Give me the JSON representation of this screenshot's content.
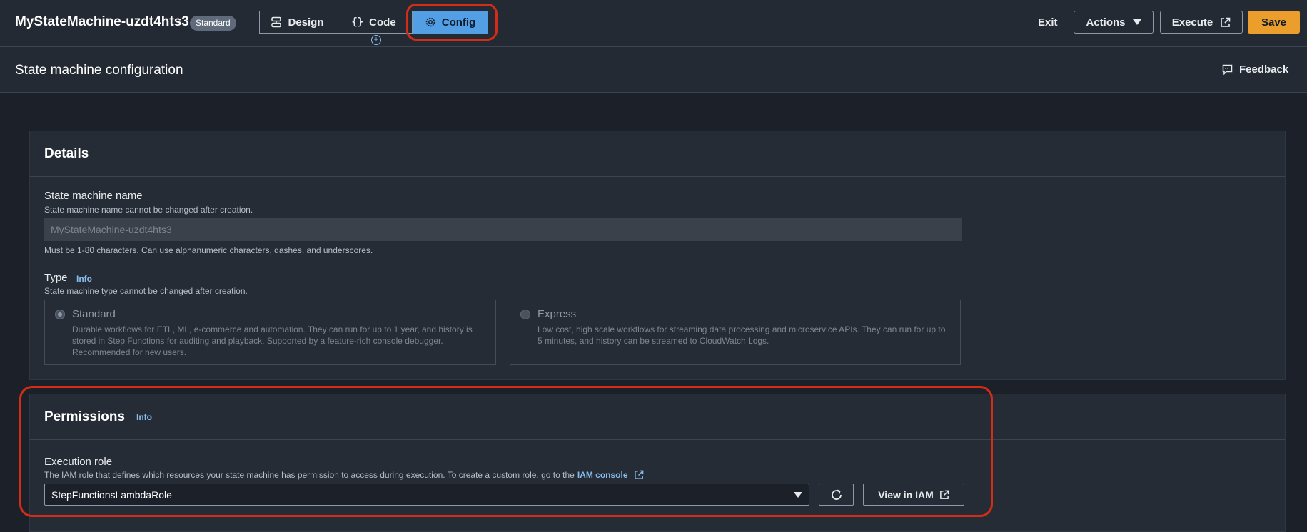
{
  "app": {
    "title": "MyStateMachine-uzdt4hts3",
    "type_badge": "Standard"
  },
  "modes": {
    "design": "Design",
    "code": "Code",
    "config": "Config",
    "active": "Config"
  },
  "toolbar": {
    "exit": "Exit",
    "actions": "Actions",
    "execute": "Execute",
    "save": "Save"
  },
  "page": {
    "title": "State machine configuration",
    "feedback": "Feedback"
  },
  "details": {
    "title": "Details",
    "name_label": "State machine name",
    "name_desc": "State machine name cannot be changed after creation.",
    "name_value": "MyStateMachine-uzdt4hts3",
    "name_hint": "Must be 1-80 characters. Can use alphanumeric characters, dashes, and underscores.",
    "type_label": "Type",
    "type_info": "Info",
    "type_desc": "State machine type cannot be changed after creation.",
    "standard": {
      "title": "Standard",
      "desc": "Durable workflows for ETL, ML, e-commerce and automation. They can run for up to 1 year, and history is stored in Step Functions for auditing and playback. Supported by a feature-rich console debugger. Recommended for new users.",
      "selected": true
    },
    "express": {
      "title": "Express",
      "desc": "Low cost, high scale workflows for streaming data processing and microservice APIs. They can run for up to 5 minutes, and history can be streamed to CloudWatch Logs.",
      "selected": false
    }
  },
  "permissions": {
    "title": "Permissions",
    "info": "Info",
    "role_label": "Execution role",
    "role_desc": "The IAM role that defines which resources your state machine has permission to access during execution. To create a custom role, go to the",
    "iam_console": "IAM console",
    "role_value": "StepFunctionsLambdaRole",
    "view_in_iam": "View in IAM"
  },
  "colors": {
    "accent": "#539fe5",
    "save": "#ec9e2c",
    "highlight": "#d42d17",
    "link": "#89bdee"
  }
}
